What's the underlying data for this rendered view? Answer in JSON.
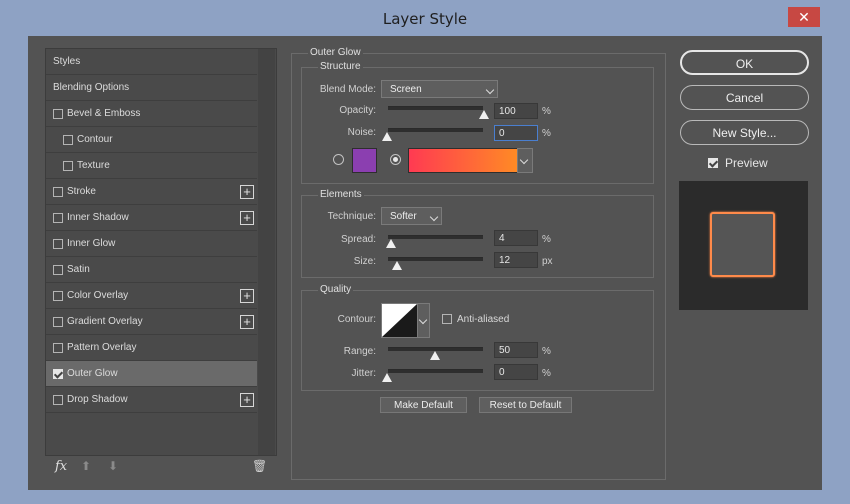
{
  "window": {
    "title": "Layer Style",
    "close_glyph": "✕"
  },
  "styles_list": {
    "items": [
      {
        "label": "Styles"
      },
      {
        "label": "Blending Options"
      },
      {
        "label": "Bevel & Emboss"
      },
      {
        "label": "Contour"
      },
      {
        "label": "Texture"
      },
      {
        "label": "Stroke"
      },
      {
        "label": "Inner Shadow"
      },
      {
        "label": "Inner Glow"
      },
      {
        "label": "Satin"
      },
      {
        "label": "Color Overlay"
      },
      {
        "label": "Gradient Overlay"
      },
      {
        "label": "Pattern Overlay"
      },
      {
        "label": "Outer Glow"
      },
      {
        "label": "Drop Shadow"
      }
    ],
    "footer": {
      "fx_label": "fx",
      "up_glyph": "⬆",
      "down_glyph": "⬇",
      "trash_glyph": "🗑"
    }
  },
  "outer_glow": {
    "section_title": "Outer Glow",
    "structure": {
      "title": "Structure",
      "blend_mode_label": "Blend Mode:",
      "blend_mode_value": "Screen",
      "opacity_label": "Opacity:",
      "opacity_value": "100",
      "noise_label": "Noise:",
      "noise_value": "0",
      "percent": "%",
      "solid_color": "#8b3fb0",
      "gradient_from": "#ff3a52",
      "gradient_to": "#ff8a25"
    },
    "elements": {
      "title": "Elements",
      "technique_label": "Technique:",
      "technique_value": "Softer",
      "spread_label": "Spread:",
      "spread_value": "4",
      "spread_unit": "%",
      "size_label": "Size:",
      "size_value": "12",
      "size_unit": "px"
    },
    "quality": {
      "title": "Quality",
      "contour_label": "Contour:",
      "anti_aliased_label": "Anti-aliased",
      "range_label": "Range:",
      "range_value": "50",
      "range_unit": "%",
      "jitter_label": "Jitter:",
      "jitter_value": "0",
      "jitter_unit": "%"
    },
    "make_default_label": "Make Default",
    "reset_default_label": "Reset to Default"
  },
  "actions": {
    "ok_label": "OK",
    "cancel_label": "Cancel",
    "new_style_label": "New Style...",
    "preview_label": "Preview"
  },
  "preview": {
    "swatch_fill": "#555555",
    "glow_color": "#ff8a4a"
  }
}
